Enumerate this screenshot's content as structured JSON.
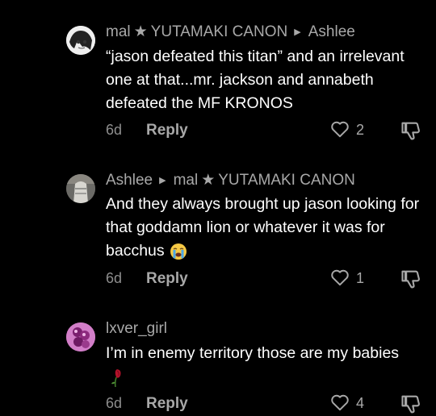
{
  "comments": [
    {
      "author": "mal",
      "author_suffix": "YUTAMAKI CANON",
      "reply_to": "Ashlee",
      "text": "“jason defeated this titan” and an irrelevant one at that...mr. jackson and annabeth defeated the MF KRONOS",
      "age": "6d",
      "reply_label": "Reply",
      "likes": "2"
    },
    {
      "author": "Ashlee",
      "reply_to": "mal",
      "reply_to_suffix": "YUTAMAKI CANON",
      "text": "And they always brought up jason looking for that goddamn lion or whatever it was for bacchus",
      "emoji": "crying-face",
      "age": "6d",
      "reply_label": "Reply",
      "likes": "1"
    },
    {
      "author": "lxver_girl",
      "text": "I’m in enemy territory those are my babies",
      "emoji": "wilted-rose",
      "age": "6d",
      "reply_label": "Reply",
      "likes": "4"
    }
  ],
  "icons": {
    "star": "★",
    "reply_arrow": "▶"
  },
  "colors": {
    "background": "#000000",
    "text": "#ffffff",
    "muted": "#a8a8a8"
  }
}
